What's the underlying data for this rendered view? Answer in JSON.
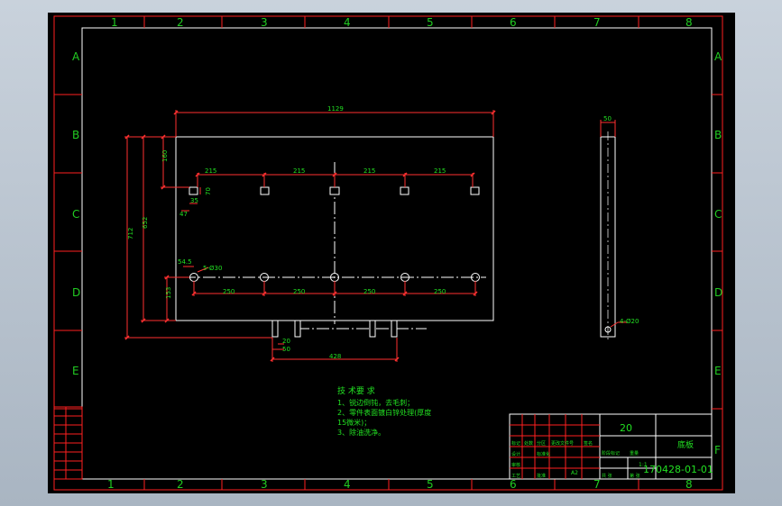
{
  "colors": {
    "background": "#000000",
    "border_red": "#ff2020",
    "geometry_white": "#ffffff",
    "dimension_red": "#ff3030",
    "dimension_text_green": "#22e022",
    "zone_label_green": "#22cc22"
  },
  "zones": {
    "columns": [
      "1",
      "2",
      "3",
      "4",
      "5",
      "6",
      "7",
      "8"
    ],
    "rows": [
      "A",
      "B",
      "C",
      "D",
      "E",
      "F"
    ]
  },
  "front_view": {
    "overall_width": "1129",
    "top_offset": "160",
    "overall_height": "712",
    "inner_height": "652",
    "bottom_offset": "153",
    "slot_pitch": [
      "215",
      "215",
      "215",
      "215"
    ],
    "slot_width": "35",
    "slot_depth": "70",
    "slot_edge": "47",
    "hole_edge": "54.5",
    "hole_callout": "5-Ø30",
    "hole_pitch": [
      "250",
      "250",
      "250",
      "250"
    ],
    "tab_width": "20",
    "tab_offset": "50",
    "tab_span": "428"
  },
  "side_view": {
    "thickness": "50",
    "hole_callout": "4-Ø20"
  },
  "notes": {
    "heading": "技 术要 求",
    "lines": [
      "1、锐边倒钝，去毛刺；",
      "2、零件表面镀白锌处理(厚度",
      "15微米)；",
      "3、除油洗净。"
    ]
  },
  "title_block": {
    "quantity": "20",
    "part_name": "底板",
    "drawing_number": "170428-01-01",
    "scale": "1:1",
    "sheet": "A2",
    "small_labels": [
      "标记",
      "处数",
      "分区",
      "更改文件号",
      "签名",
      "年月日",
      "设计",
      "标准化",
      "审核",
      "工艺",
      "批准",
      "阶段标记",
      "重量",
      "比例",
      "共 张",
      "第 张"
    ]
  }
}
